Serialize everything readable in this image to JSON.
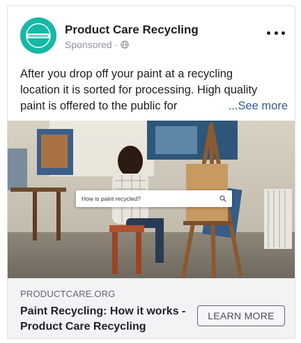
{
  "post": {
    "page_name": "Product Care Recycling",
    "sponsored_label": "Sponsored ·",
    "body_lines": [
      "After you drop off your paint at a recycling",
      "location it is sorted for processing. High quality",
      "paint is offered to the public for"
    ],
    "see_more_label": "...See more"
  },
  "media": {
    "search_query": "How is paint recycled?"
  },
  "link_preview": {
    "domain": "PRODUCTCARE.ORG",
    "headline": "Paint Recycling: How it works - Product Care Recycling",
    "cta_label": "LEARN MORE"
  },
  "colors": {
    "brand_teal": "#17b8a6",
    "link_blue": "#385898",
    "muted_text": "#90949c",
    "link_area_bg": "#f2f3f5"
  },
  "icons": {
    "avatar": "product-care-logo",
    "privacy": "globe-icon",
    "menu": "more-options-icon",
    "search": "search-icon"
  }
}
